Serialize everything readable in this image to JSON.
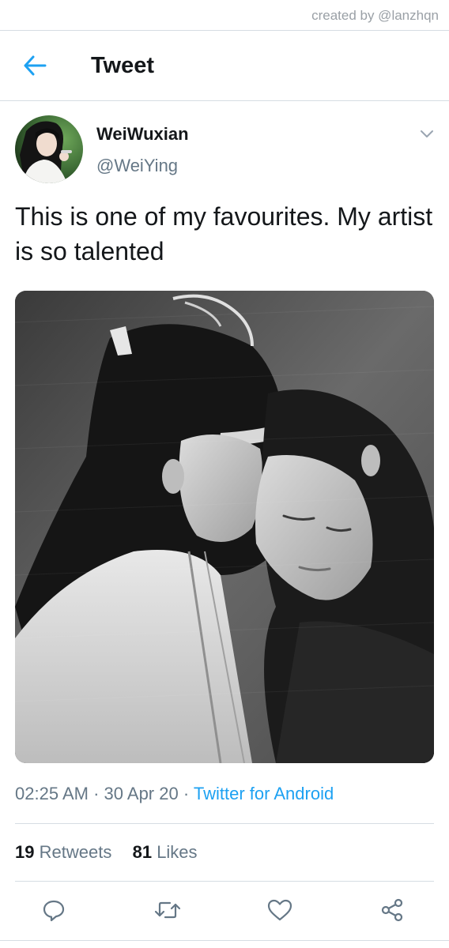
{
  "watermark": {
    "credit": "created by @lanzhqn"
  },
  "header": {
    "title": "Tweet",
    "back_icon": "arrow-left-icon"
  },
  "tweet": {
    "author": {
      "display_name": "WeiWuxian",
      "handle": "@WeiYing",
      "avatar_icon": "avatar-photo"
    },
    "text": "This is one of my favourites. My artist is so talented",
    "media": {
      "kind": "photo",
      "description_icon": "attached-photo"
    },
    "time": "02:25 AM",
    "separator": "·",
    "date": "30 Apr 20",
    "source": "Twitter for Android",
    "stats": {
      "retweets_count": "19",
      "retweets_label": "Retweets",
      "likes_count": "81",
      "likes_label": "Likes"
    },
    "actions": [
      "reply-icon",
      "retweet-icon",
      "like-icon",
      "share-icon"
    ]
  },
  "colors": {
    "accent": "#1da1f2",
    "text_primary": "#14171a",
    "text_secondary": "#657786",
    "divider": "#d6dde3"
  }
}
